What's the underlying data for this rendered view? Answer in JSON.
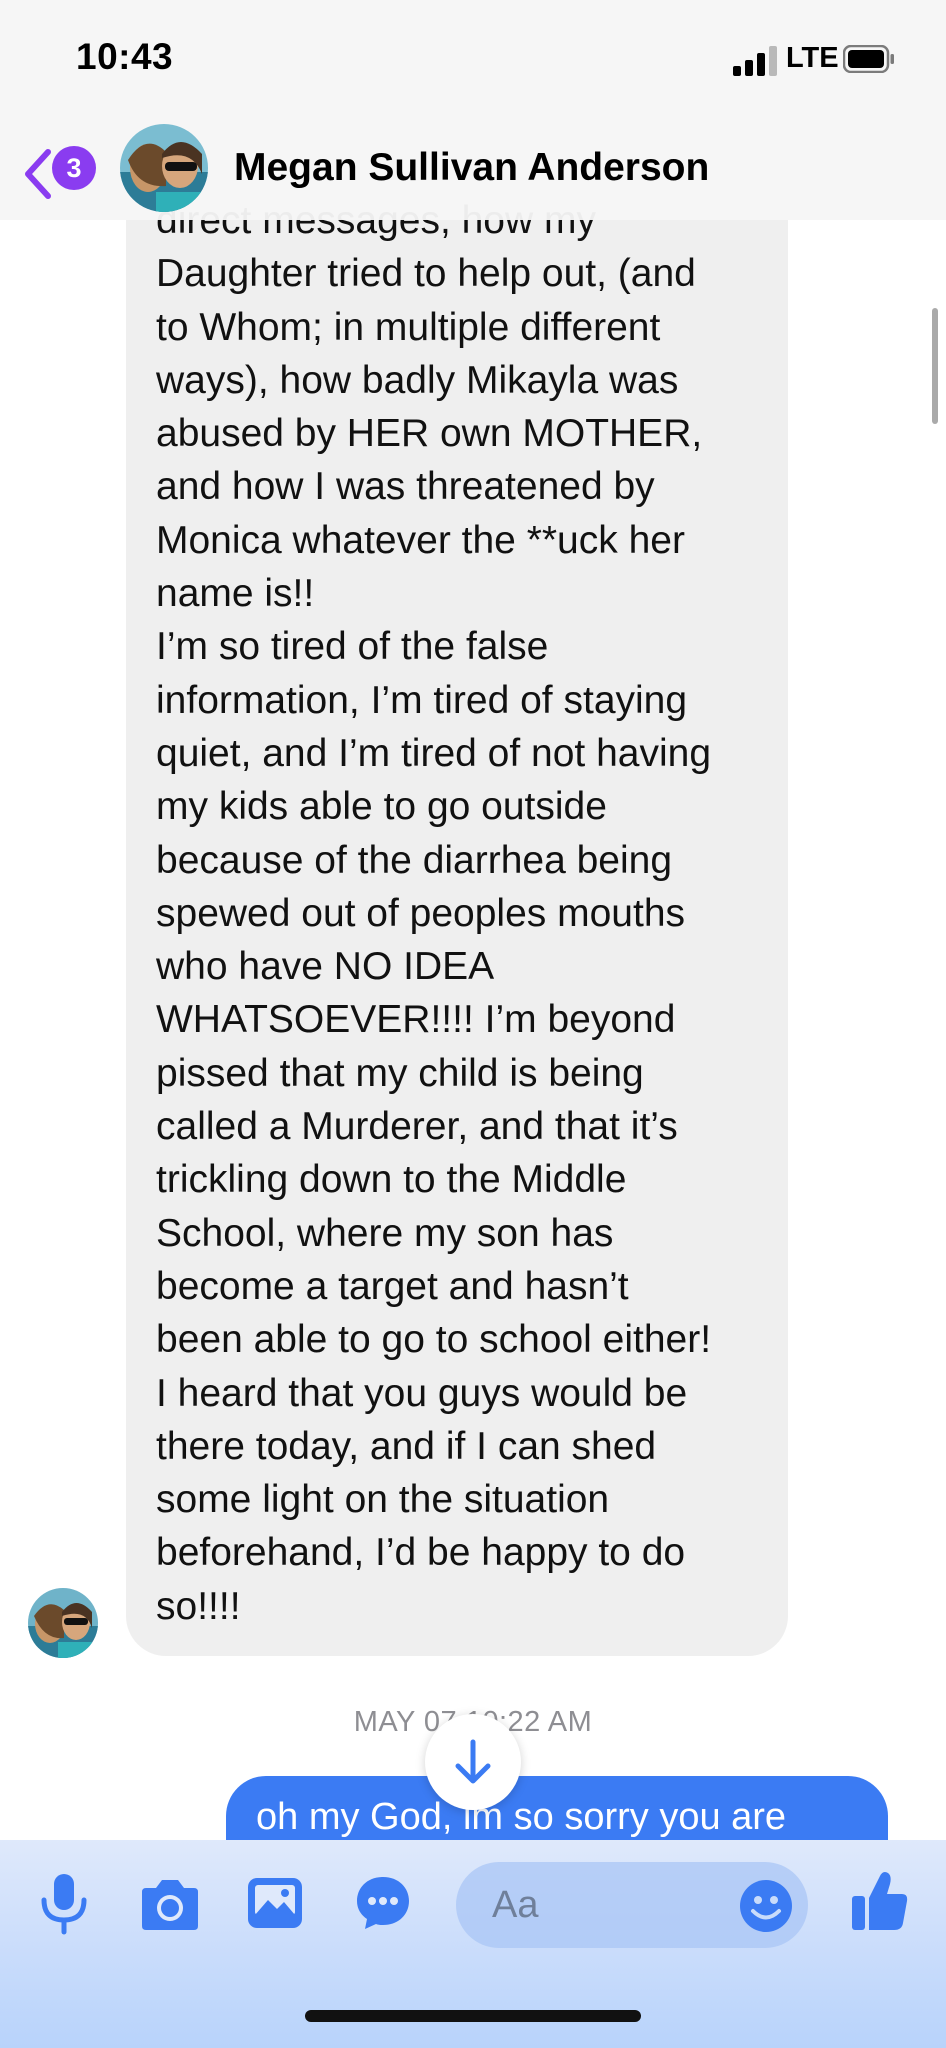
{
  "status_bar": {
    "time": "10:43",
    "network": "LTE"
  },
  "header": {
    "unread_badge": "3",
    "contact_name": "Megan Sullivan Anderson"
  },
  "thread": {
    "incoming_message": "direct messages, how my\nDaughter tried to help out, (and\nto Whom; in multiple different\nways), how badly Mikayla was\nabused by HER own MOTHER,\nand how I was threatened by\nMonica whatever the **uck her\nname is!!\nI’m so tired of the false\ninformation, I’m tired of staying\nquiet, and I’m tired of not having\nmy kids able to go outside\nbecause of the diarrhea being\nspewed out of peoples mouths\nwho have NO IDEA\nWHATSOEVER!!!! I’m beyond\npissed that my child is being\ncalled a Murderer, and that it’s\ntrickling down to the Middle\nSchool, where my son has\nbecome a target and hasn’t\nbeen able to go to school either!\nI heard that you guys would be\nthere today, and if I can shed\nsome light on the situation\nbeforehand, I’d be happy to do\nso!!!!",
    "timestamp": "MAY 07 10:22 AM",
    "outgoing_message": "oh my God, im so sorry you are"
  },
  "composer": {
    "placeholder": "Aa"
  },
  "colors": {
    "accent": "#3b7bf3",
    "incoming_bubble": "#efefef",
    "badge": "#8a3cf0"
  },
  "icons": [
    "back-chevron-icon",
    "microphone-icon",
    "camera-icon",
    "gallery-icon",
    "chat-bubble-icon",
    "emoji-icon",
    "thumbs-up-icon",
    "scroll-down-arrow-icon"
  ]
}
